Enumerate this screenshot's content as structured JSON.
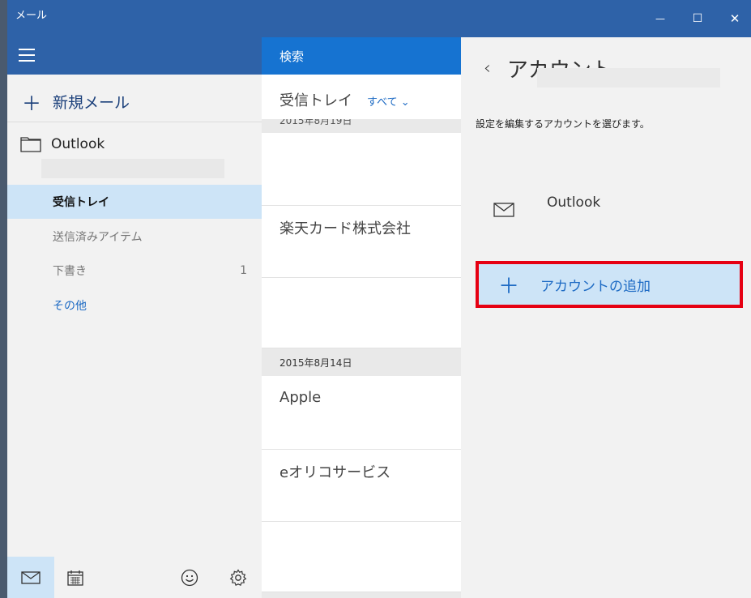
{
  "window": {
    "title": "メール",
    "minimize_glyph": "—",
    "maximize_glyph": "☐",
    "close_glyph": "✕"
  },
  "sidebar": {
    "new_mail_icon": "＋",
    "new_mail_label": "新規メール",
    "account_name": "Outlook",
    "folders": [
      {
        "label": "受信トレイ",
        "count": ""
      },
      {
        "label": "送信済みアイテム",
        "count": ""
      },
      {
        "label": "下書き",
        "count": "1"
      },
      {
        "label": "その他",
        "count": ""
      }
    ],
    "bottom_icons": [
      "mail-icon",
      "calendar-icon",
      "smiley-icon",
      "gear-icon"
    ]
  },
  "message_list": {
    "search_label": "検索",
    "inbox_title": "受信トレイ",
    "filter_label": "すべて ⌄",
    "top_date": "2015年8月19日",
    "date_header": "2015年8月14日",
    "messages": [
      "楽天カード株式会社",
      "Apple",
      "eオリコサービス"
    ]
  },
  "account_pane": {
    "back_glyph": "‹",
    "title": "アカウント",
    "subtitle": "設定を編集するアカウントを選びます。",
    "account_name": "Outlook",
    "add_icon": "＋",
    "add_label": "アカウントの追加"
  },
  "colors": {
    "titlebar": "#2e62a8",
    "search_bar": "#1673d1",
    "selection": "#cde4f7",
    "highlight_border": "#e60012",
    "accent_text": "#1e6bc4"
  }
}
